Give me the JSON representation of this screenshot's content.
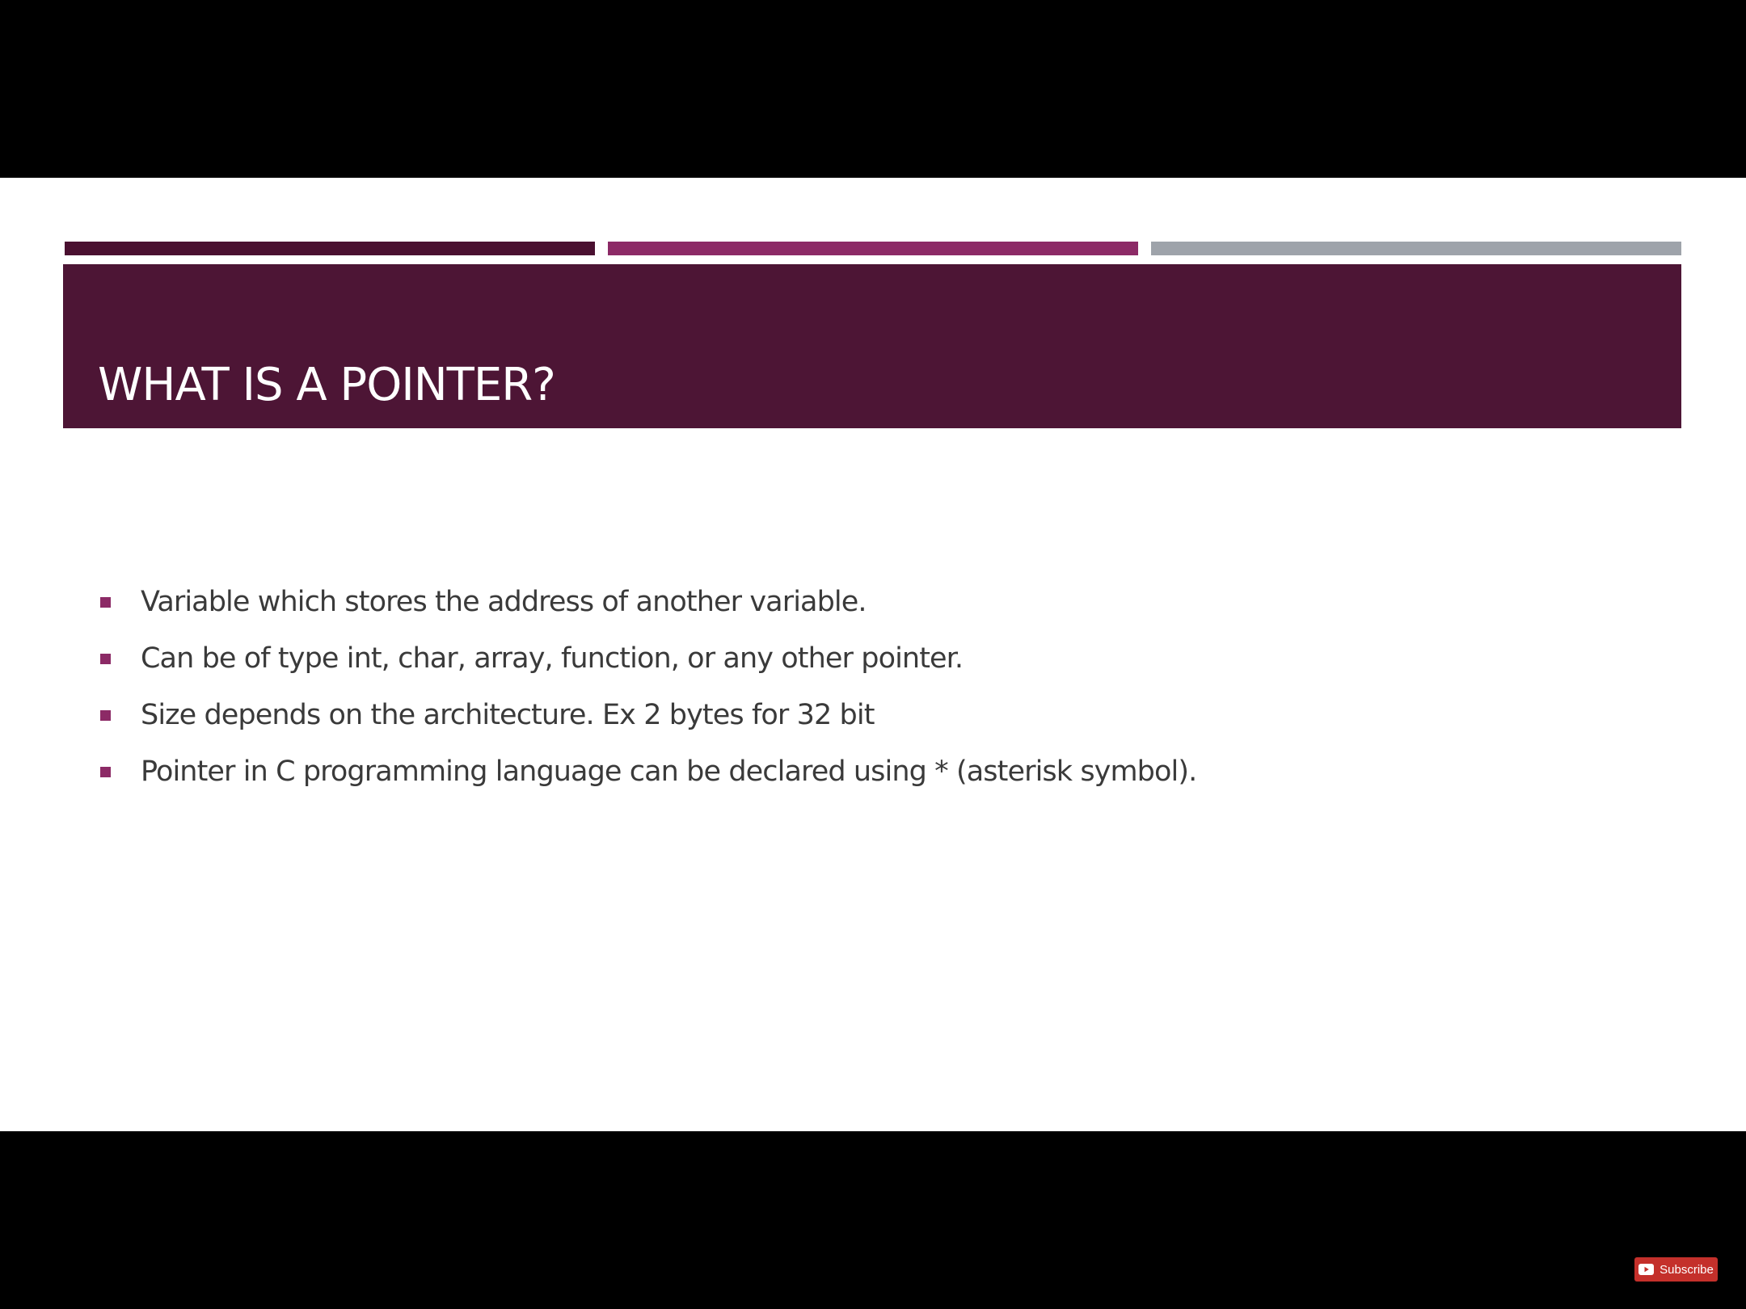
{
  "slide": {
    "title": "WHAT IS A POINTER?",
    "bullets": [
      "Variable which stores the address of another variable.",
      "Can be of type int, char, array, function, or any other pointer.",
      "Size depends on the architecture. Ex 2 bytes for 32 bit",
      "Pointer in C programming language can be declared using * (asterisk symbol)."
    ]
  },
  "player": {
    "subscribe_label": "Subscribe",
    "subscribe_icon": "youtube-play-icon"
  },
  "colors": {
    "background": "#000000",
    "slide_background": "#ffffff",
    "title_band": "#4d1535",
    "accent_bar_dark": "#4a1030",
    "accent_bar_magenta": "#8c2a66",
    "accent_bar_gray": "#9ea3aa",
    "bullet_marker": "#8c2a66",
    "body_text": "#3a3a3a",
    "subscribe_button": "#c4302b"
  }
}
